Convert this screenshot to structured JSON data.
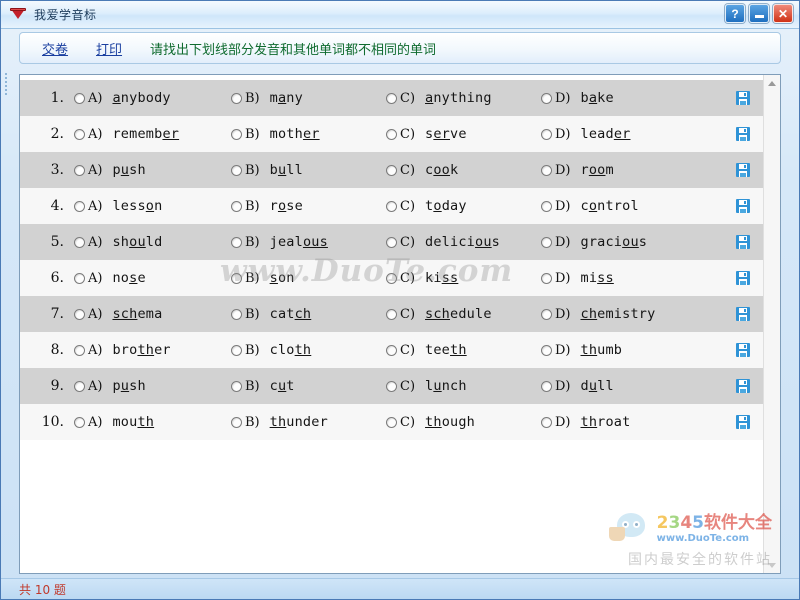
{
  "window": {
    "title": "我爱学音标",
    "icon": "cup-icon",
    "buttons": [
      {
        "name": "help-button",
        "label": "?"
      },
      {
        "name": "minimize-button",
        "label": ""
      },
      {
        "name": "close-button",
        "label": "✕"
      }
    ]
  },
  "toolbar": {
    "submit_label": "交卷",
    "print_label": "打印",
    "instruction": "请找出下划线部分发音和其他单词都不相同的单词",
    "link_color": "#1a3fa0",
    "instruction_color": "#0f6b2f"
  },
  "questions": [
    {
      "number": "1.",
      "options": [
        {
          "letter": "A)",
          "pre": "",
          "mark": "a",
          "post": "nybody"
        },
        {
          "letter": "B)",
          "pre": "m",
          "mark": "a",
          "post": "ny"
        },
        {
          "letter": "C)",
          "pre": "",
          "mark": "a",
          "post": "nything"
        },
        {
          "letter": "D)",
          "pre": "b",
          "mark": "a",
          "post": "ke"
        }
      ]
    },
    {
      "number": "2.",
      "options": [
        {
          "letter": "A)",
          "pre": "rememb",
          "mark": "er",
          "post": ""
        },
        {
          "letter": "B)",
          "pre": "moth",
          "mark": "er",
          "post": ""
        },
        {
          "letter": "C)",
          "pre": "s",
          "mark": "er",
          "post": "ve"
        },
        {
          "letter": "D)",
          "pre": "lead",
          "mark": "er",
          "post": ""
        }
      ]
    },
    {
      "number": "3.",
      "options": [
        {
          "letter": "A)",
          "pre": "p",
          "mark": "u",
          "post": "sh"
        },
        {
          "letter": "B)",
          "pre": "b",
          "mark": "u",
          "post": "ll"
        },
        {
          "letter": "C)",
          "pre": "c",
          "mark": "oo",
          "post": "k"
        },
        {
          "letter": "D)",
          "pre": "r",
          "mark": "oo",
          "post": "m"
        }
      ]
    },
    {
      "number": "4.",
      "options": [
        {
          "letter": "A)",
          "pre": "less",
          "mark": "o",
          "post": "n"
        },
        {
          "letter": "B)",
          "pre": "r",
          "mark": "o",
          "post": "se"
        },
        {
          "letter": "C)",
          "pre": "t",
          "mark": "o",
          "post": "day"
        },
        {
          "letter": "D)",
          "pre": "c",
          "mark": "o",
          "post": "ntrol"
        }
      ]
    },
    {
      "number": "5.",
      "options": [
        {
          "letter": "A)",
          "pre": "sh",
          "mark": "ou",
          "post": "ld"
        },
        {
          "letter": "B)",
          "pre": "jeal",
          "mark": "ous",
          "post": ""
        },
        {
          "letter": "C)",
          "pre": "delici",
          "mark": "ou",
          "post": "s"
        },
        {
          "letter": "D)",
          "pre": "graci",
          "mark": "ou",
          "post": "s"
        }
      ]
    },
    {
      "number": "6.",
      "options": [
        {
          "letter": "A)",
          "pre": "no",
          "mark": "s",
          "post": "e"
        },
        {
          "letter": "B)",
          "pre": "",
          "mark": "s",
          "post": "on"
        },
        {
          "letter": "C)",
          "pre": "ki",
          "mark": "ss",
          "post": ""
        },
        {
          "letter": "D)",
          "pre": "mi",
          "mark": "ss",
          "post": ""
        }
      ]
    },
    {
      "number": "7.",
      "options": [
        {
          "letter": "A)",
          "pre": "",
          "mark": "sch",
          "post": "ema"
        },
        {
          "letter": "B)",
          "pre": "cat",
          "mark": "ch",
          "post": ""
        },
        {
          "letter": "C)",
          "pre": "",
          "mark": "sch",
          "post": "edule"
        },
        {
          "letter": "D)",
          "pre": "",
          "mark": "ch",
          "post": "emistry"
        }
      ]
    },
    {
      "number": "8.",
      "options": [
        {
          "letter": "A)",
          "pre": "bro",
          "mark": "th",
          "post": "er"
        },
        {
          "letter": "B)",
          "pre": "clo",
          "mark": "th",
          "post": ""
        },
        {
          "letter": "C)",
          "pre": "tee",
          "mark": "th",
          "post": ""
        },
        {
          "letter": "D)",
          "pre": "",
          "mark": "th",
          "post": "umb"
        }
      ]
    },
    {
      "number": "9.",
      "options": [
        {
          "letter": "A)",
          "pre": "p",
          "mark": "u",
          "post": "sh"
        },
        {
          "letter": "B)",
          "pre": "c",
          "mark": "u",
          "post": "t"
        },
        {
          "letter": "C)",
          "pre": "l",
          "mark": "u",
          "post": "nch"
        },
        {
          "letter": "D)",
          "pre": "d",
          "mark": "u",
          "post": "ll"
        }
      ]
    },
    {
      "number": "10.",
      "options": [
        {
          "letter": "A)",
          "pre": "mou",
          "mark": "th",
          "post": ""
        },
        {
          "letter": "B)",
          "pre": "",
          "mark": "th",
          "post": "under"
        },
        {
          "letter": "C)",
          "pre": "",
          "mark": "th",
          "post": "ough"
        },
        {
          "letter": "D)",
          "pre": "",
          "mark": "th",
          "post": "roat"
        }
      ]
    }
  ],
  "watermarks": {
    "center": "www.DuoTe.com",
    "brand_digits": [
      "2",
      "3",
      "4",
      "5"
    ],
    "brand_zh": "软件大全",
    "url": "www.DuoTe.com",
    "slogan": "国内最安全的软件站"
  },
  "statusbar": {
    "text": "共 10 题",
    "color": "#c0392b"
  },
  "scrollbar": {
    "up_arrow": "scroll-up-arrow",
    "down_arrow": "scroll-down-arrow"
  }
}
